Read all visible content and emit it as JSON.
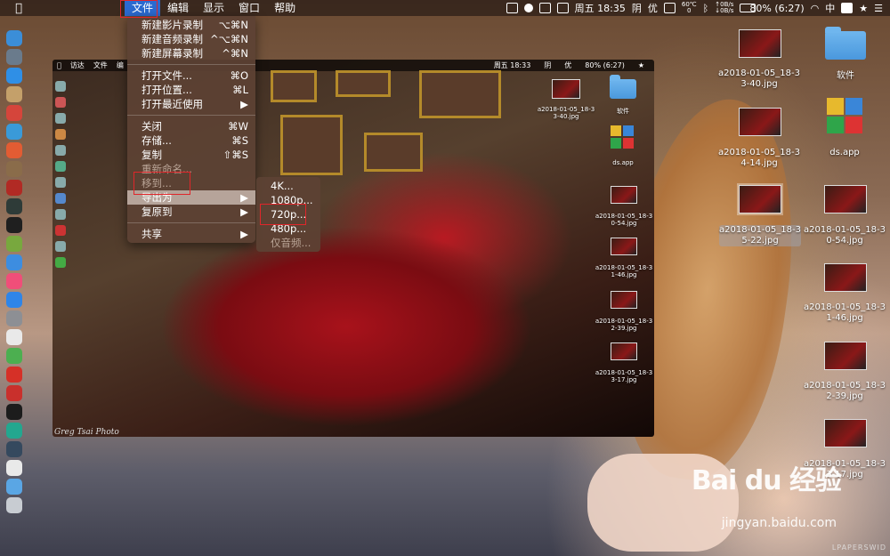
{
  "menubar": {
    "apple_icon": "apple-icon",
    "items": [
      {
        "label": "文件",
        "active": true
      },
      {
        "label": "编辑"
      },
      {
        "label": "显示"
      },
      {
        "label": "窗口"
      },
      {
        "label": "帮助"
      }
    ],
    "status": {
      "temp_top": "60℃",
      "temp_bottom": "0",
      "net_up": "↑0B/s",
      "net_down": "↓0B/s",
      "clock": "周五 18:35",
      "weather": "阴",
      "input_method": "优",
      "battery": "80% (6:27)"
    }
  },
  "file_menu": {
    "items": [
      {
        "label": "新建影片录制",
        "shortcut": "⌥⌘N"
      },
      {
        "label": "新建音频录制",
        "shortcut": "^⌥⌘N"
      },
      {
        "label": "新建屏幕录制",
        "shortcut": "^⌘N"
      },
      {
        "label": "打开文件...",
        "shortcut": "⌘O"
      },
      {
        "label": "打开位置...",
        "shortcut": "⌘L"
      },
      {
        "label": "打开最近使用",
        "shortcut": "▶"
      },
      {
        "label": "关闭",
        "shortcut": "⌘W"
      },
      {
        "label": "存储...",
        "shortcut": "⌘S"
      },
      {
        "label": "复制",
        "shortcut": "⇧⌘S"
      },
      {
        "label": "重新命名...",
        "shortcut": ""
      },
      {
        "label": "移到...",
        "shortcut": ""
      },
      {
        "label": "导出为",
        "shortcut": "▶"
      },
      {
        "label": "复原到",
        "shortcut": "▶"
      },
      {
        "label": "共享",
        "shortcut": "▶"
      }
    ]
  },
  "export_submenu": {
    "items": [
      {
        "label": "4K..."
      },
      {
        "label": "1080p..."
      },
      {
        "label": "720p..."
      },
      {
        "label": "480p..."
      },
      {
        "label": "仅音频..."
      }
    ]
  },
  "screenshot": {
    "menubar": [
      "访达",
      "文件",
      "编"
    ],
    "clock": "周五 18:33",
    "weather": "阴",
    "input_method": "优",
    "battery": "80% (6:27)",
    "watermark": "Greg Tsai Photo",
    "files": [
      {
        "name": "a2018-01-05_18-3\n3-40.jpg"
      },
      {
        "name": "软件"
      },
      {
        "name": "ds.app"
      },
      {
        "name": "a2018-01-05_18-3\n0-54.jpg"
      },
      {
        "name": "a2018-01-05_18-3\n1-46.jpg"
      },
      {
        "name": "a2018-01-05_18-3\n2-39.jpg"
      },
      {
        "name": "a2018-01-05_18-3\n3-17.jpg"
      }
    ]
  },
  "desktop": {
    "icons": [
      {
        "name": "a2018-01-05_18-3\n3-40.jpg"
      },
      {
        "name": "软件"
      },
      {
        "name": "a2018-01-05_18-3\n4-14.jpg"
      },
      {
        "name": "ds.app"
      },
      {
        "name": "a2018-01-05_18-3\n5-22.jpg"
      },
      {
        "name": "a2018-01-05_18-3\n0-54.jpg"
      },
      {
        "name": "a2018-01-05_18-3\n1-46.jpg"
      },
      {
        "name": "a2018-01-05_18-3\n2-39.jpg"
      },
      {
        "name": "a2018-01-05_18-3\n3-17.jpg"
      }
    ]
  },
  "watermarks": {
    "baidu": "Bai du 经验",
    "baidu_url": "jingyan.baidu.com",
    "wallpaper": "LPAPERSWID"
  },
  "colors": {
    "menu_highlight": "#2b6ad0",
    "red_box": "#e0262a"
  }
}
